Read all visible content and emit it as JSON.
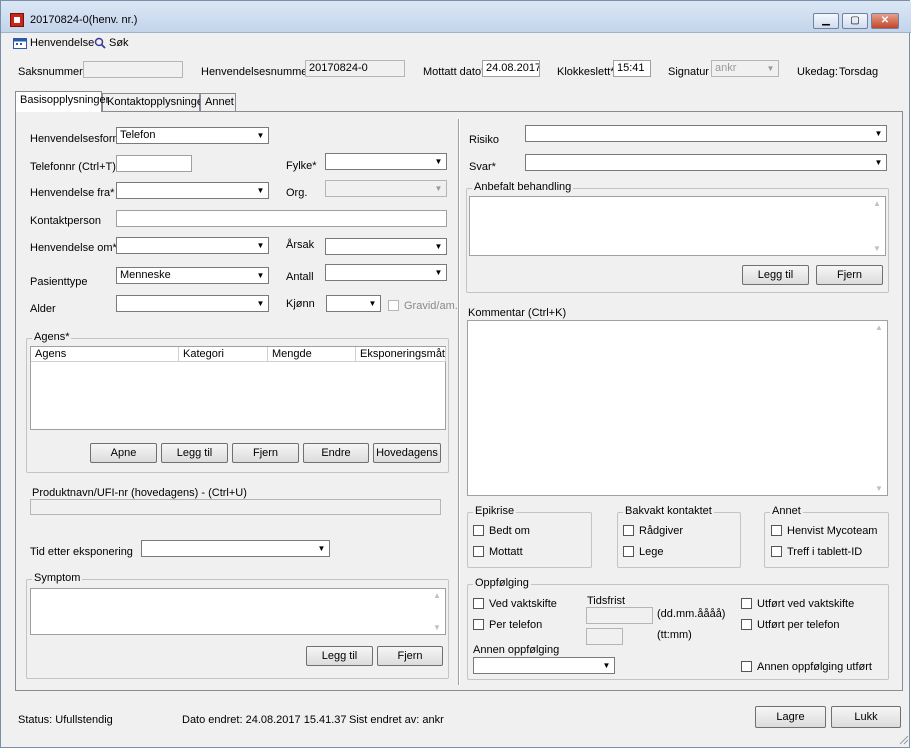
{
  "window": {
    "title": "20170824-0(henv. nr.)",
    "min": "▁",
    "max": "▢",
    "close": "✕"
  },
  "menu": {
    "item1": "Henvendelse",
    "item2": "Søk"
  },
  "header": {
    "saksnummer_label": "Saksnummer",
    "saksnummer_value": "",
    "henv_nr_label": "Henvendelsesnummer",
    "henv_nr_value": "20170824-0",
    "mottatt_label": "Mottatt dato*",
    "mottatt_value": "24.08.2017",
    "klokkeslett_label": "Klokkeslett*",
    "klokkeslett_value": "15:41",
    "signatur_label": "Signatur",
    "signatur_value": "ankr",
    "ukedag_label": "Ukedag:",
    "ukedag_value": "Torsdag"
  },
  "tabs": [
    "Basisopplysninger",
    "Kontaktopplysninger",
    "Annet"
  ],
  "left": {
    "henvendelsesform_label": "Henvendelsesform*",
    "henvendelsesform_value": "Telefon",
    "telefonnr_label": "Telefonnr (Ctrl+T)",
    "fylke_label": "Fylke*",
    "henvendelse_fra_label": "Henvendelse fra*",
    "org_label": "Org.",
    "kontaktperson_label": "Kontaktperson",
    "henvendelse_om_label": "Henvendelse om*",
    "arsak_label": "Årsak",
    "pasienttype_label": "Pasienttype",
    "pasienttype_value": "Menneske",
    "antall_label": "Antall",
    "alder_label": "Alder",
    "kjonn_label": "Kjønn",
    "gravid_label": "Gravid/am.",
    "agens_group": "Agens*",
    "agens_cols": [
      "Agens",
      "Kategori",
      "Mengde",
      "Eksponeringsmåte"
    ],
    "agens_buttons": [
      "Apne",
      "Legg til",
      "Fjern",
      "Endre",
      "Hovedagens"
    ],
    "produkt_label": "Produktnavn/UFI-nr (hovedagens) - (Ctrl+U)",
    "tid_label": "Tid etter eksponering",
    "symptom_group": "Symptom",
    "symptom_buttons": [
      "Legg til",
      "Fjern"
    ]
  },
  "right": {
    "risiko_label": "Risiko",
    "svar_label": "Svar*",
    "anbefalt_group": "Anbefalt behandling",
    "anbefalt_buttons": [
      "Legg til",
      "Fjern"
    ],
    "kommentar_label": "Kommentar (Ctrl+K)",
    "epikrise_group": "Epikrise",
    "epikrise_items": [
      "Bedt om",
      "Mottatt"
    ],
    "bakvakt_group": "Bakvakt kontaktet",
    "bakvakt_items": [
      "Rådgiver",
      "Lege"
    ],
    "annet_group": "Annet",
    "annet_items": [
      "Henvist Mycoteam",
      "Treff i tablett-ID"
    ],
    "oppfolging_group": "Oppfølging",
    "ved_vaktskifte": "Ved vaktskifte",
    "per_telefon": "Per telefon",
    "tidsfrist_label": "Tidsfrist",
    "date_hint": "(dd.mm.åååå)",
    "time_hint": "(tt:mm)",
    "utfort_vakt": "Utført ved vaktskifte",
    "utfort_tlf": "Utført per telefon",
    "annen_label": "Annen oppfølging",
    "annen_utfort": "Annen oppfølging utført"
  },
  "status": {
    "status_text": "Status: Ufullstendig",
    "dato_endret": "Dato endret: 24.08.2017 15.41.37",
    "sist_endret": "Sist endret av: ankr",
    "lagre": "Lagre",
    "lukk": "Lukk"
  }
}
